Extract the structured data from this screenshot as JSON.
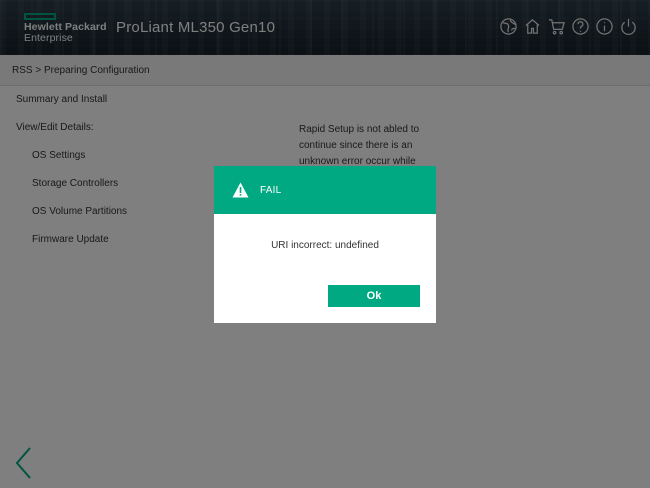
{
  "header": {
    "brand_line1": "Hewlett Packard",
    "brand_line2": "Enterprise",
    "product": "ProLiant ML350 Gen10",
    "icons": [
      "globe-icon",
      "home-icon",
      "cart-icon",
      "help-icon",
      "info-icon",
      "power-icon"
    ]
  },
  "breadcrumb": "RSS > Preparing Configuration",
  "nav": {
    "items": [
      {
        "label": "Summary and Install"
      },
      {
        "label": "View/Edit Details:"
      },
      {
        "label": "OS Settings"
      },
      {
        "label": "Storage Controllers"
      },
      {
        "label": "OS Volume Partitions"
      },
      {
        "label": "Firmware Update"
      }
    ]
  },
  "message": "Rapid Setup is not abled to continue since there is an unknown error occur while",
  "dialog": {
    "title": "FAIL",
    "body": "URI incorrect: undefined",
    "ok_label": "Ok"
  },
  "colors": {
    "accent": "#01a982",
    "header_bg": "#1e2a33"
  }
}
